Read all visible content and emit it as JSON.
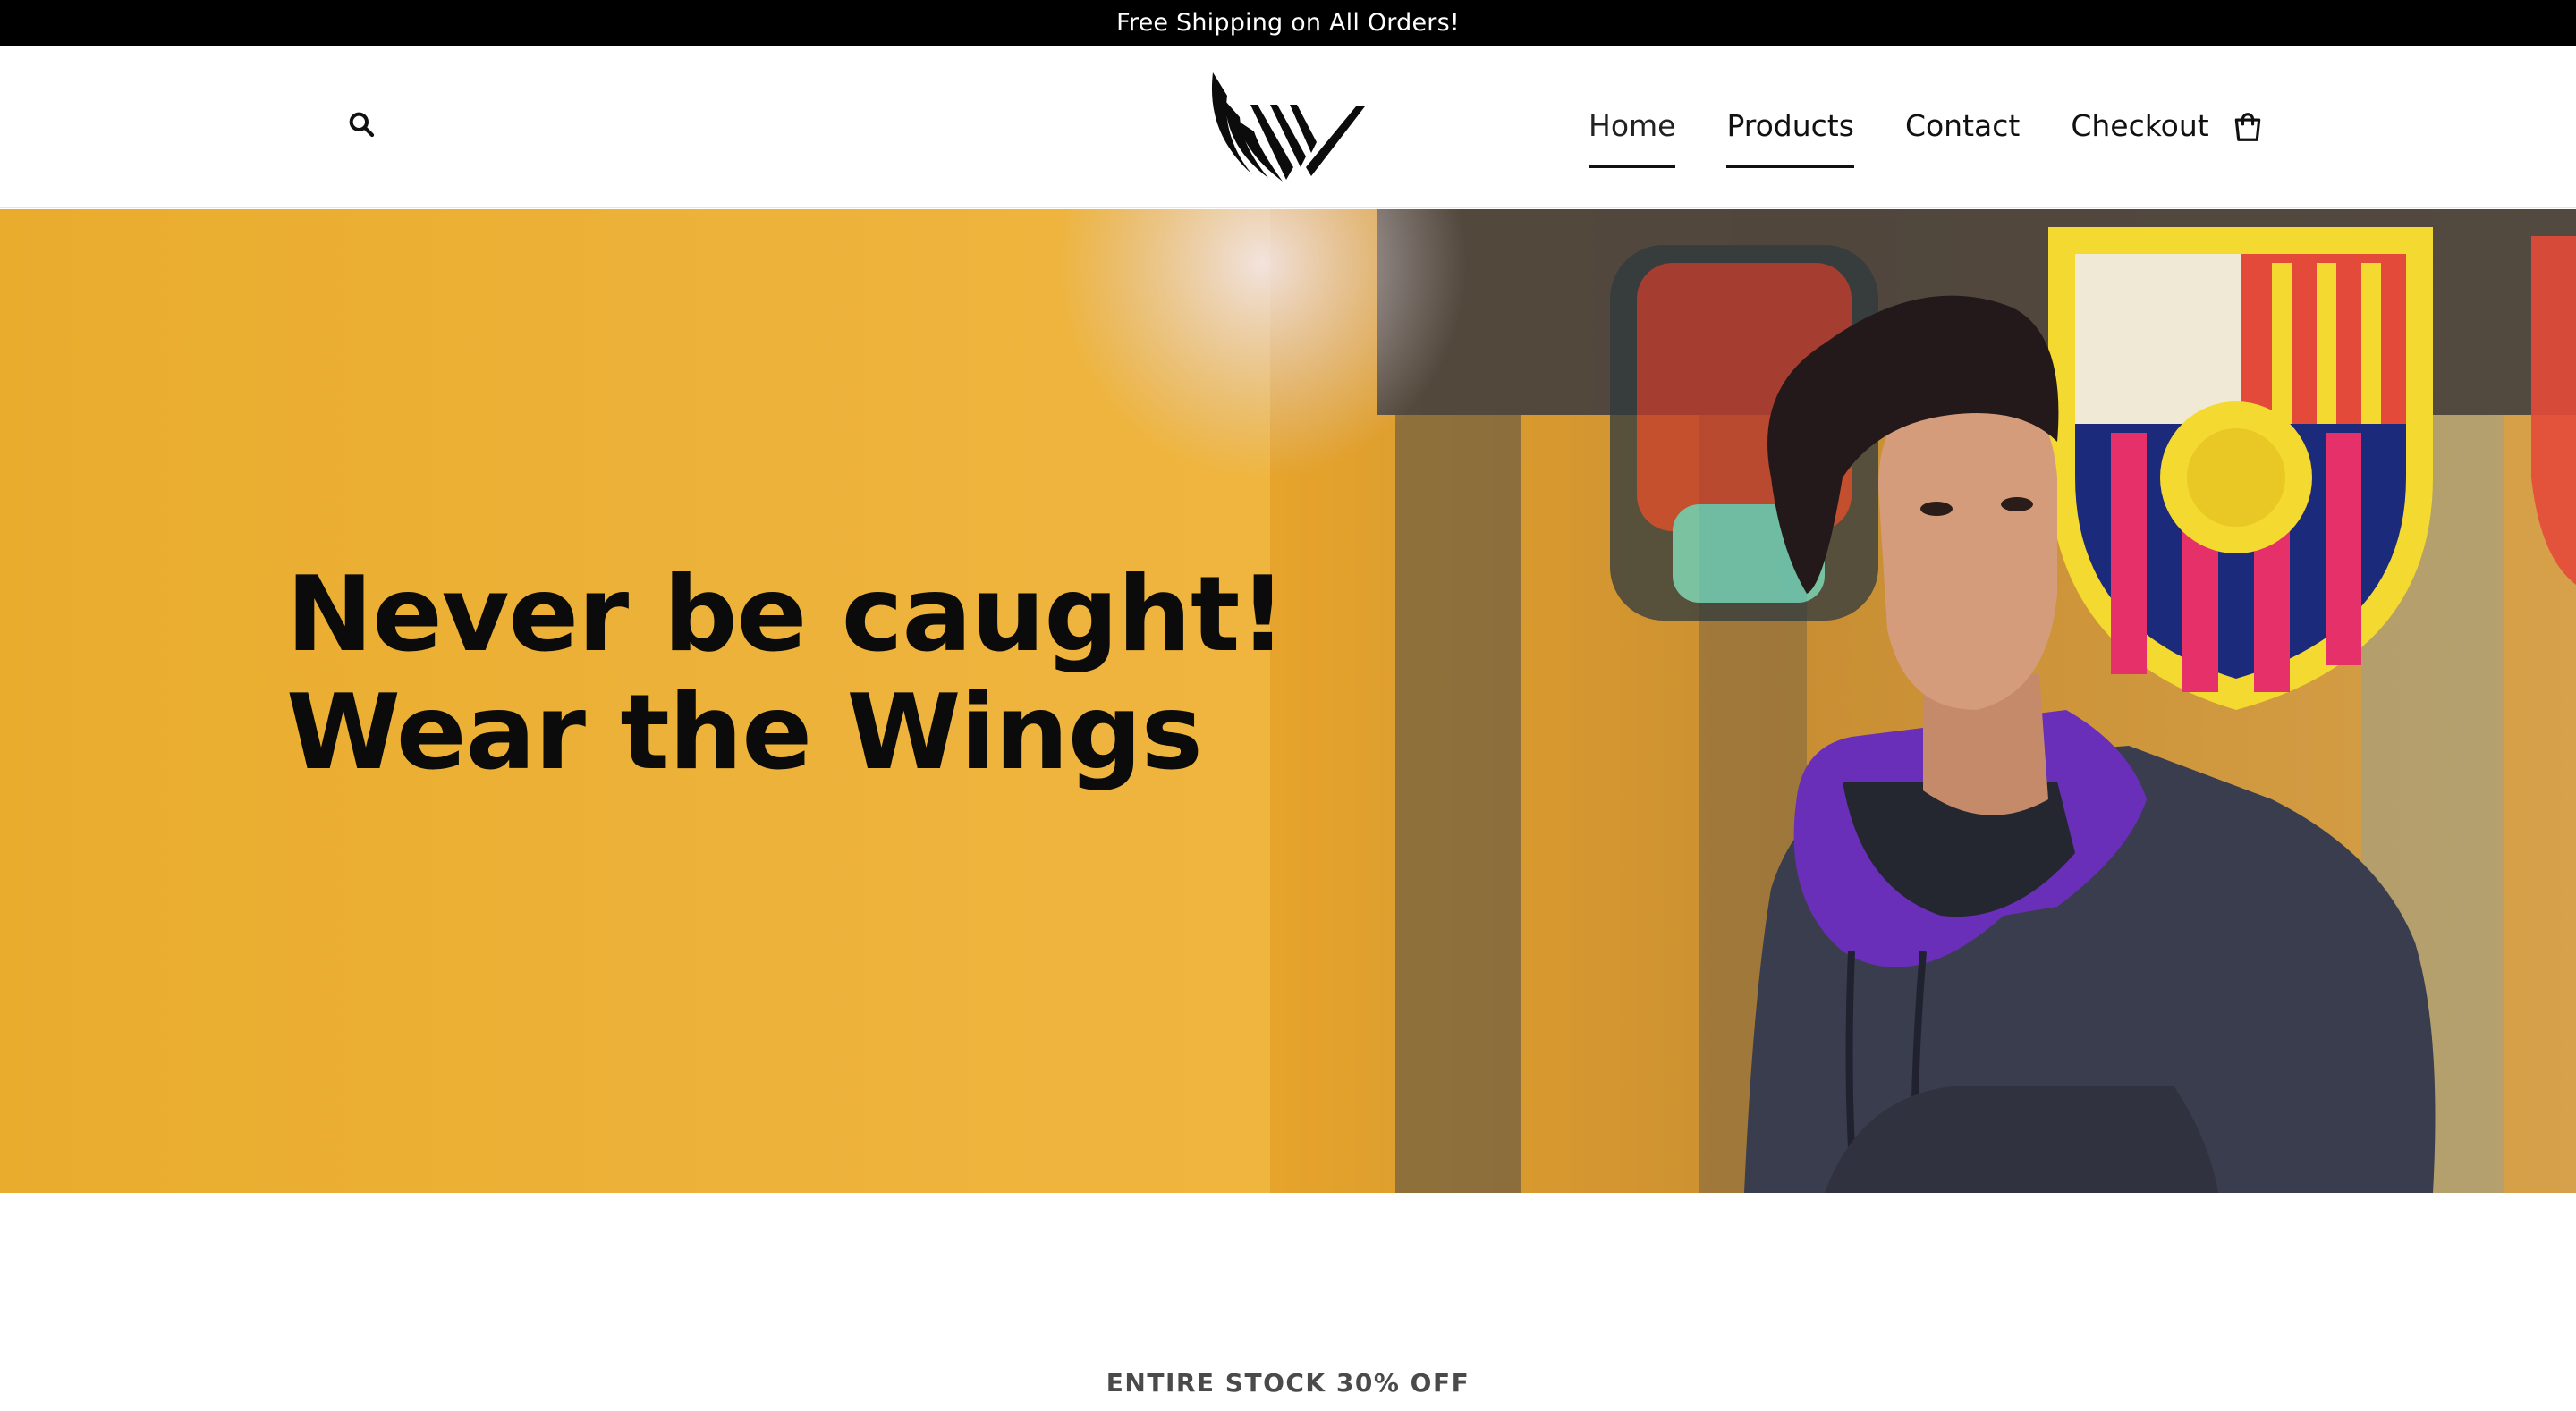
{
  "announcement": {
    "text": "Free Shipping on All Orders!"
  },
  "header": {
    "search_icon": "search-icon",
    "logo": "wings-logo",
    "nav": [
      {
        "label": "Home",
        "active": true
      },
      {
        "label": "Products",
        "active": true
      },
      {
        "label": "Contact",
        "active": false
      },
      {
        "label": "Checkout",
        "active": false
      }
    ],
    "cart_icon": "shopping-bag-icon"
  },
  "hero": {
    "headline_line1": "Never be caught!",
    "headline_line2": "Wear the Wings",
    "background_color": "#efb53f"
  },
  "promo": {
    "label": "ENTIRE STOCK 30% OFF"
  }
}
